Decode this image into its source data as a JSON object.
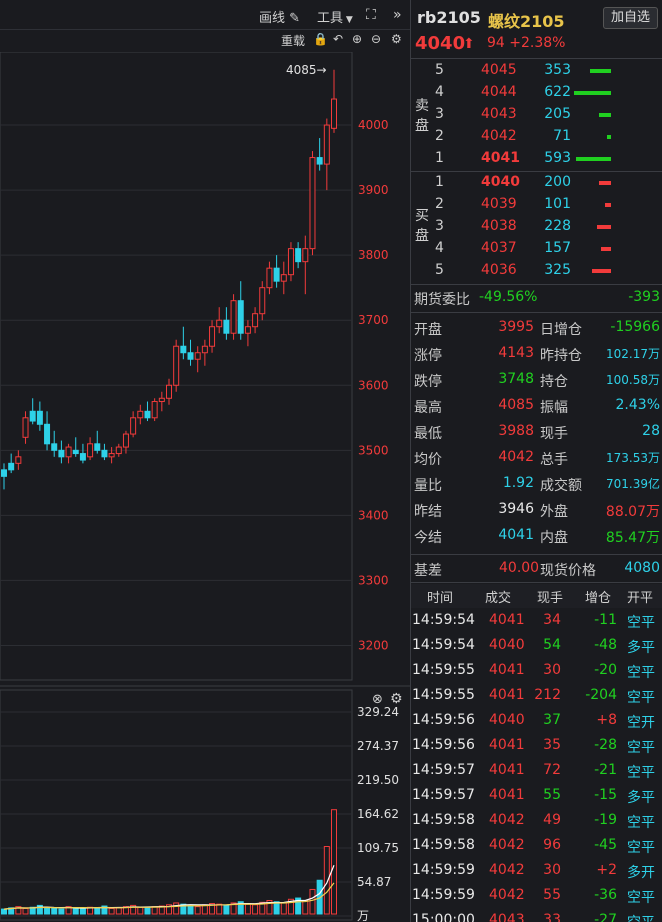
{
  "toolbar": {
    "draw_label": "画线",
    "tools_label": "工具",
    "reload_label": "重载"
  },
  "header": {
    "code": "rb2105",
    "name": "螺纹2105",
    "add_button": "加自选",
    "price": "4040",
    "change": "94",
    "change_pct": "+2.38%"
  },
  "orderbook": {
    "sell_label": "卖盘",
    "buy_label": "买盘",
    "asks": [
      {
        "level": "5",
        "price": "4045",
        "volume": "353",
        "bar": 0.35
      },
      {
        "level": "4",
        "price": "4044",
        "volume": "622",
        "bar": 0.62
      },
      {
        "level": "3",
        "price": "4043",
        "volume": "205",
        "bar": 0.2
      },
      {
        "level": "2",
        "price": "4042",
        "volume": "71",
        "bar": 0.07
      },
      {
        "level": "1",
        "price": "4041",
        "volume": "593",
        "bar": 0.59
      }
    ],
    "bids": [
      {
        "level": "1",
        "price": "4040",
        "volume": "200",
        "bar": 0.2
      },
      {
        "level": "2",
        "price": "4039",
        "volume": "101",
        "bar": 0.1
      },
      {
        "level": "3",
        "price": "4038",
        "volume": "228",
        "bar": 0.23
      },
      {
        "level": "4",
        "price": "4037",
        "volume": "157",
        "bar": 0.16
      },
      {
        "level": "5",
        "price": "4036",
        "volume": "325",
        "bar": 0.32
      }
    ],
    "ratio_label": "期货委比",
    "ratio_pct": "-49.56%",
    "ratio_diff": "-393"
  },
  "stats": [
    {
      "l1": "开盘",
      "v1": "3995",
      "c1": "red",
      "l2": "日增仓",
      "v2": "-15966",
      "c2": "green"
    },
    {
      "l1": "涨停",
      "v1": "4143",
      "c1": "red",
      "l2": "昨持仓",
      "v2": "102.17万",
      "c2": "cyan"
    },
    {
      "l1": "跌停",
      "v1": "3748",
      "c1": "green",
      "l2": "持仓",
      "v2": "100.58万",
      "c2": "cyan"
    },
    {
      "l1": "最高",
      "v1": "4085",
      "c1": "red",
      "l2": "振幅",
      "v2": "2.43%",
      "c2": "cyan"
    },
    {
      "l1": "最低",
      "v1": "3988",
      "c1": "red",
      "l2": "现手",
      "v2": "28",
      "c2": "cyan"
    },
    {
      "l1": "均价",
      "v1": "4042",
      "c1": "red",
      "l2": "总手",
      "v2": "173.53万",
      "c2": "cyan"
    },
    {
      "l1": "量比",
      "v1": "1.92",
      "c1": "cyan",
      "l2": "成交额",
      "v2": "701.39亿",
      "c2": "cyan"
    },
    {
      "l1": "昨结",
      "v1": "3946",
      "c1": "white",
      "l2": "外盘",
      "v2": "88.07万",
      "c2": "red"
    },
    {
      "l1": "今结",
      "v1": "4041",
      "c1": "cyan",
      "l2": "内盘",
      "v2": "85.47万",
      "c2": "green"
    }
  ],
  "basis": {
    "label": "基差",
    "value": "40.00",
    "spot_label": "现货价格",
    "spot_value": "4080"
  },
  "tape": {
    "headers": [
      "时间",
      "成交",
      "现手",
      "增仓",
      "开平"
    ],
    "rows": [
      {
        "time": "14:59:54",
        "price": "4041",
        "qty": "34",
        "qc": "red",
        "oi": "-11",
        "oc": "green",
        "type": "空平"
      },
      {
        "time": "14:59:54",
        "price": "4040",
        "qty": "54",
        "qc": "green",
        "oi": "-48",
        "oc": "green",
        "type": "多平"
      },
      {
        "time": "14:59:55",
        "price": "4041",
        "qty": "30",
        "qc": "red",
        "oi": "-20",
        "oc": "green",
        "type": "空平"
      },
      {
        "time": "14:59:55",
        "price": "4041",
        "qty": "212",
        "qc": "red",
        "oi": "-204",
        "oc": "green",
        "type": "空平"
      },
      {
        "time": "14:59:56",
        "price": "4040",
        "qty": "37",
        "qc": "green",
        "oi": "+8",
        "oc": "red",
        "type": "空开"
      },
      {
        "time": "14:59:56",
        "price": "4041",
        "qty": "35",
        "qc": "red",
        "oi": "-28",
        "oc": "green",
        "type": "空平"
      },
      {
        "time": "14:59:57",
        "price": "4041",
        "qty": "72",
        "qc": "red",
        "oi": "-21",
        "oc": "green",
        "type": "空平"
      },
      {
        "time": "14:59:57",
        "price": "4041",
        "qty": "55",
        "qc": "green",
        "oi": "-15",
        "oc": "green",
        "type": "多平"
      },
      {
        "time": "14:59:58",
        "price": "4042",
        "qty": "49",
        "qc": "red",
        "oi": "-19",
        "oc": "green",
        "type": "空平"
      },
      {
        "time": "14:59:58",
        "price": "4042",
        "qty": "96",
        "qc": "red",
        "oi": "-45",
        "oc": "green",
        "type": "空平"
      },
      {
        "time": "14:59:59",
        "price": "4042",
        "qty": "30",
        "qc": "red",
        "oi": "+2",
        "oc": "red",
        "type": "多开"
      },
      {
        "time": "14:59:59",
        "price": "4042",
        "qty": "55",
        "qc": "red",
        "oi": "-36",
        "oc": "green",
        "type": "空平"
      },
      {
        "time": "15:00:00",
        "price": "4043",
        "qty": "33",
        "qc": "red",
        "oi": "-27",
        "oc": "green",
        "type": "空平"
      }
    ]
  },
  "chart_data": {
    "type": "candlestick",
    "ylim": [
      3150,
      4100
    ],
    "yticks": [
      4000,
      3900,
      3800,
      3700,
      3600,
      3500,
      3400,
      3300,
      3200
    ],
    "high_label": "4085→",
    "candles": [
      [
        3470,
        3480,
        3440,
        3460
      ],
      [
        3480,
        3495,
        3465,
        3470
      ],
      [
        3480,
        3500,
        3470,
        3490
      ],
      [
        3520,
        3560,
        3510,
        3550
      ],
      [
        3560,
        3580,
        3540,
        3545
      ],
      [
        3560,
        3575,
        3530,
        3540
      ],
      [
        3540,
        3560,
        3500,
        3510
      ],
      [
        3510,
        3530,
        3490,
        3500
      ],
      [
        3500,
        3515,
        3480,
        3490
      ],
      [
        3490,
        3510,
        3480,
        3505
      ],
      [
        3500,
        3520,
        3490,
        3495
      ],
      [
        3495,
        3510,
        3480,
        3485
      ],
      [
        3490,
        3520,
        3485,
        3510
      ],
      [
        3510,
        3530,
        3495,
        3500
      ],
      [
        3500,
        3510,
        3485,
        3490
      ],
      [
        3490,
        3505,
        3480,
        3495
      ],
      [
        3495,
        3510,
        3490,
        3505
      ],
      [
        3505,
        3530,
        3495,
        3525
      ],
      [
        3525,
        3560,
        3520,
        3550
      ],
      [
        3550,
        3570,
        3540,
        3560
      ],
      [
        3560,
        3575,
        3545,
        3550
      ],
      [
        3550,
        3580,
        3545,
        3575
      ],
      [
        3575,
        3590,
        3560,
        3580
      ],
      [
        3580,
        3610,
        3570,
        3600
      ],
      [
        3600,
        3670,
        3590,
        3660
      ],
      [
        3660,
        3690,
        3640,
        3650
      ],
      [
        3650,
        3670,
        3630,
        3640
      ],
      [
        3640,
        3660,
        3620,
        3650
      ],
      [
        3650,
        3670,
        3630,
        3660
      ],
      [
        3660,
        3700,
        3650,
        3690
      ],
      [
        3690,
        3720,
        3680,
        3700
      ],
      [
        3700,
        3720,
        3670,
        3680
      ],
      [
        3680,
        3740,
        3670,
        3730
      ],
      [
        3730,
        3760,
        3670,
        3680
      ],
      [
        3680,
        3700,
        3660,
        3690
      ],
      [
        3690,
        3720,
        3680,
        3710
      ],
      [
        3710,
        3760,
        3700,
        3750
      ],
      [
        3750,
        3790,
        3740,
        3780
      ],
      [
        3780,
        3800,
        3750,
        3760
      ],
      [
        3760,
        3790,
        3740,
        3770
      ],
      [
        3770,
        3820,
        3760,
        3810
      ],
      [
        3810,
        3820,
        3780,
        3790
      ],
      [
        3790,
        3830,
        3740,
        3810
      ],
      [
        3810,
        3960,
        3800,
        3950
      ],
      [
        3950,
        3980,
        3930,
        3940
      ],
      [
        3940,
        4010,
        3900,
        4000
      ],
      [
        3995,
        4085,
        3988,
        4040
      ]
    ],
    "volume": {
      "yticks": [
        "329.24",
        "274.37",
        "219.50",
        "164.62",
        "109.75",
        "54.87",
        "万"
      ],
      "bars": [
        8,
        10,
        12,
        9,
        11,
        14,
        10,
        9,
        8,
        12,
        10,
        9,
        11,
        10,
        13,
        9,
        10,
        12,
        14,
        11,
        10,
        12,
        13,
        15,
        18,
        16,
        14,
        12,
        15,
        17,
        16,
        14,
        18,
        20,
        17,
        15,
        19,
        22,
        20,
        18,
        24,
        26,
        22,
        40,
        55,
        110,
        170
      ]
    }
  }
}
